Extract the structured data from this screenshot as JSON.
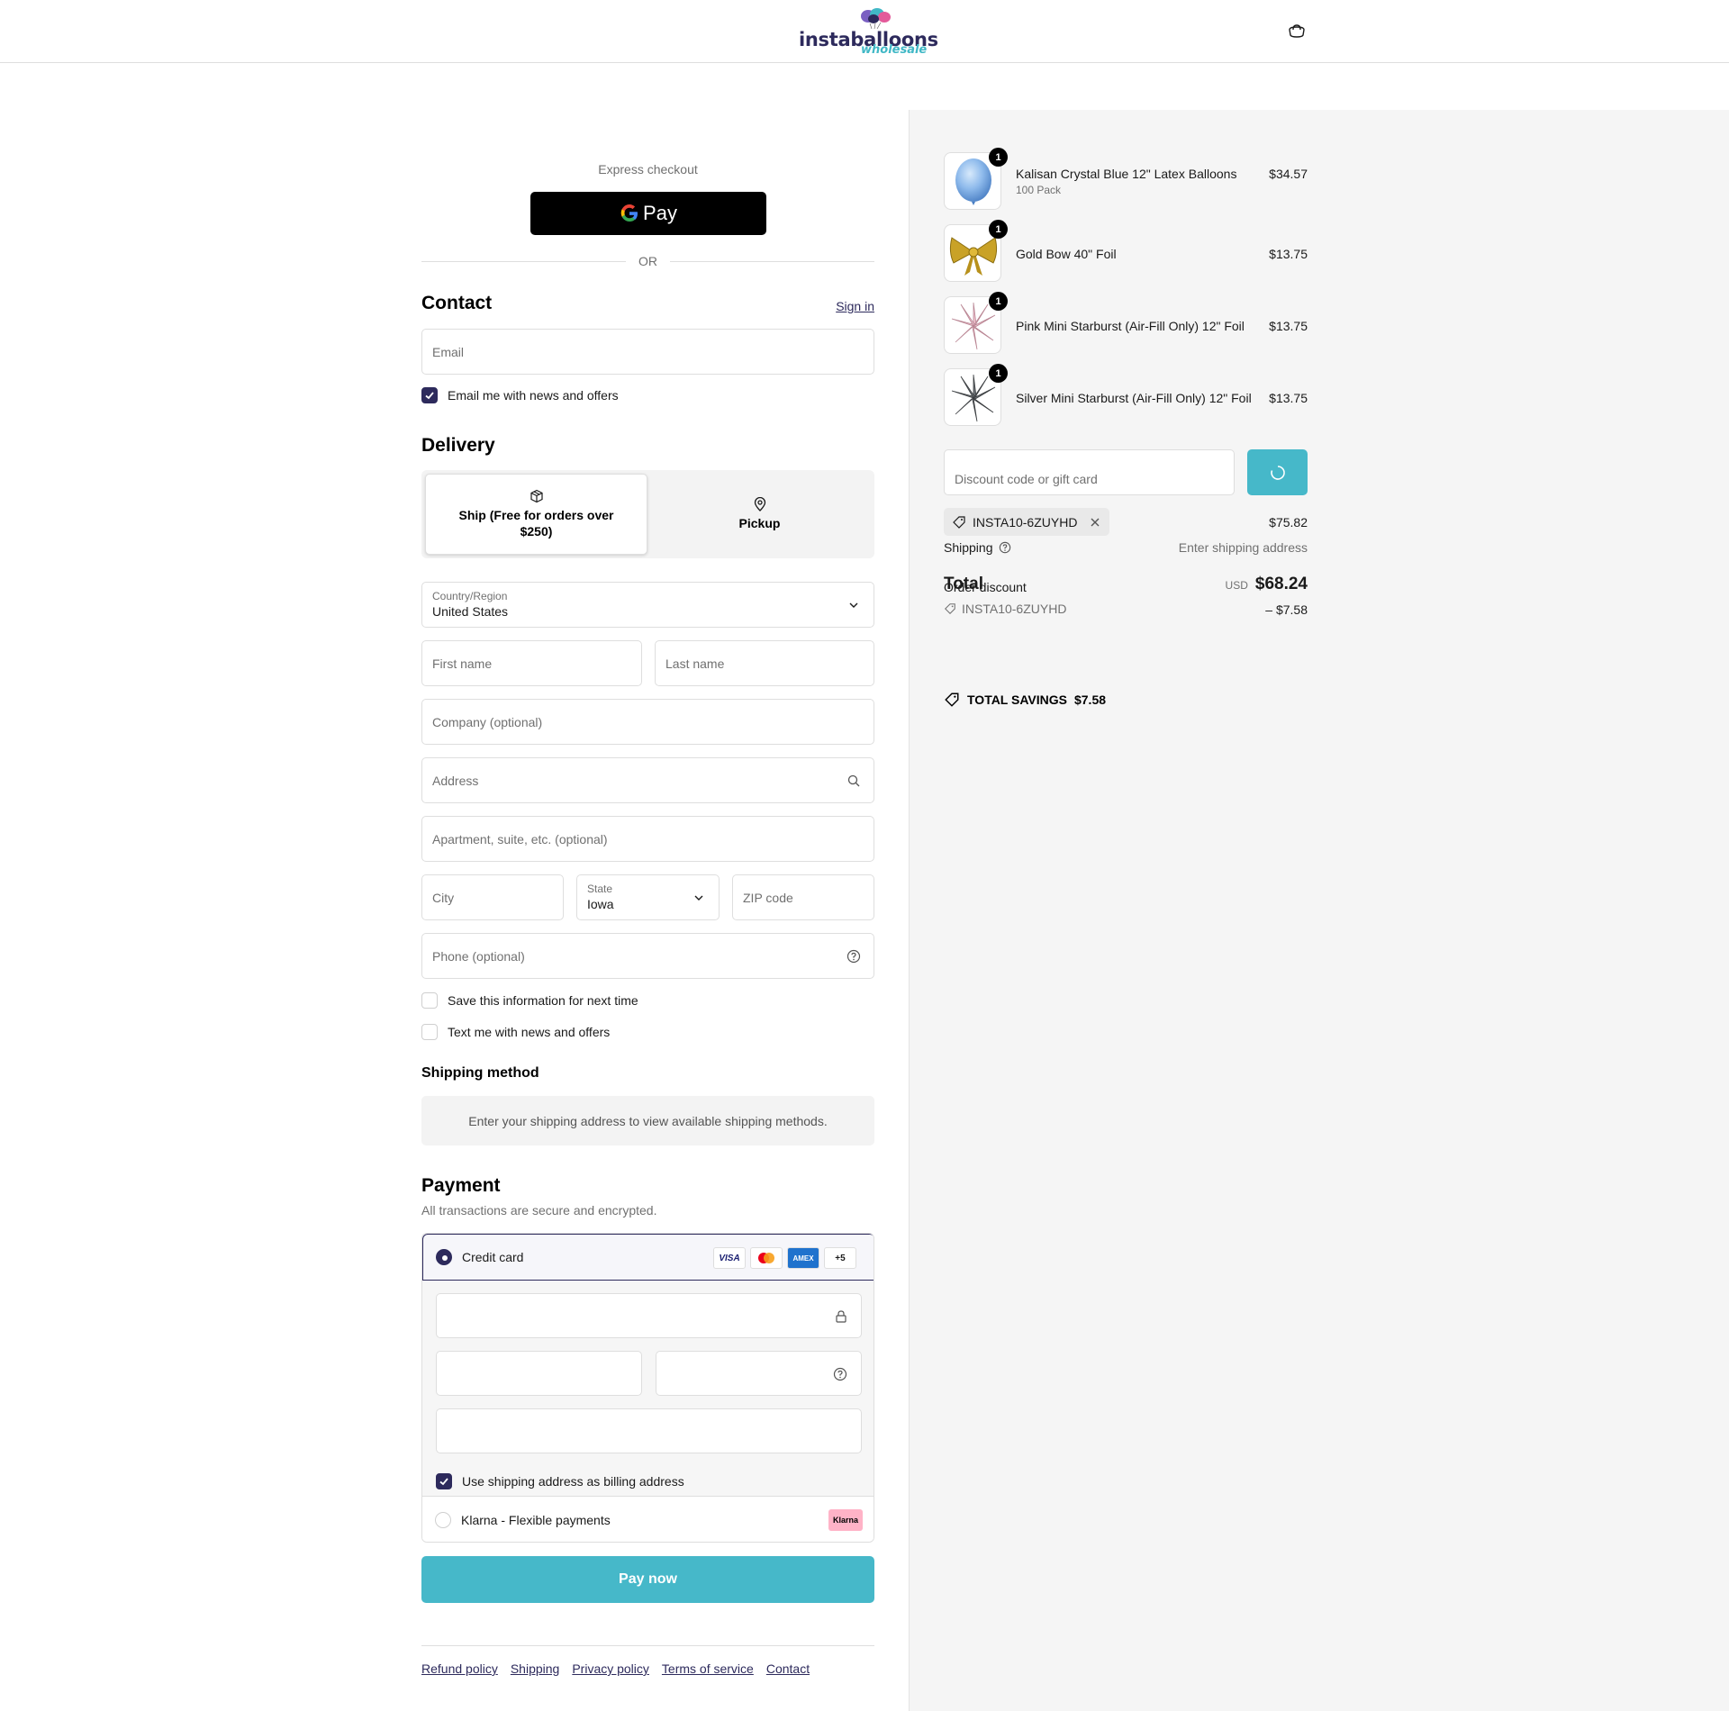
{
  "header": {
    "brand_text": "instaballoons",
    "brand_sub": "wholesale",
    "cart_icon": "cart-icon"
  },
  "express": {
    "label": "Express checkout",
    "gpay_label": "Pay",
    "or_label": "OR"
  },
  "contact": {
    "title": "Contact",
    "sign_in": "Sign in",
    "email_placeholder": "Email",
    "news_label": "Email me with news and offers",
    "news_checked": true
  },
  "delivery": {
    "title": "Delivery",
    "options": [
      {
        "label": "Ship (Free for orders over $250)",
        "icon": "box-icon",
        "selected": true
      },
      {
        "label": "Pickup",
        "icon": "location-pin-icon",
        "selected": false
      }
    ],
    "country_label": "Country/Region",
    "country_value": "United States",
    "first_name": "First name",
    "last_name": "Last name",
    "company": "Company (optional)",
    "address": "Address",
    "apartment": "Apartment, suite, etc. (optional)",
    "city": "City",
    "state_label": "State",
    "state_value": "Iowa",
    "zip": "ZIP code",
    "phone": "Phone (optional)",
    "save_info": "Save this information for next time",
    "text_me": "Text me with news and offers"
  },
  "shipping_method": {
    "title": "Shipping method",
    "message": "Enter your shipping address to view available shipping methods."
  },
  "payment": {
    "title": "Payment",
    "subtitle": "All transactions are secure and encrypted.",
    "credit_card_label": "Credit card",
    "card_logos": [
      "VISA",
      "",
      "AMEX",
      "+5"
    ],
    "billing_label": "Use shipping address as billing address",
    "billing_checked": true,
    "klarna_label": "Klarna - Flexible payments",
    "klarna_badge": "Klarna",
    "pay_now": "Pay now"
  },
  "footer": {
    "links": [
      "Refund policy",
      "Shipping",
      "Privacy policy",
      "Terms of service",
      "Contact"
    ]
  },
  "summary": {
    "items": [
      {
        "name": "Kalisan Crystal Blue 12\" Latex Balloons",
        "variant": "100 Pack",
        "price": "$34.57",
        "qty": "1",
        "image": "blue-balloon"
      },
      {
        "name": "Gold Bow 40\" Foil",
        "variant": "",
        "price": "$13.75",
        "qty": "1",
        "image": "gold-bow"
      },
      {
        "name": "Pink Mini Starburst (Air-Fill Only) 12\" Foil",
        "variant": "",
        "price": "$13.75",
        "qty": "1",
        "image": "pink-starburst"
      },
      {
        "name": "Silver Mini Starburst (Air-Fill Only) 12\" Foil",
        "variant": "",
        "price": "$13.75",
        "qty": "1",
        "image": "silver-starburst"
      }
    ],
    "discount_placeholder": "Discount code or gift card",
    "applied_code": "INSTA10-6ZUYHD",
    "subtotal": "$75.82",
    "shipping_label": "Shipping",
    "shipping_value": "Enter shipping address",
    "total_label": "Total",
    "currency": "USD",
    "total_value": "$68.24",
    "order_discount_label": "Order discount",
    "order_discount_code": "INSTA10-6ZUYHD",
    "order_discount_value": "– $7.58",
    "total_savings_label": "TOTAL SAVINGS",
    "total_savings_value": "$7.58"
  }
}
